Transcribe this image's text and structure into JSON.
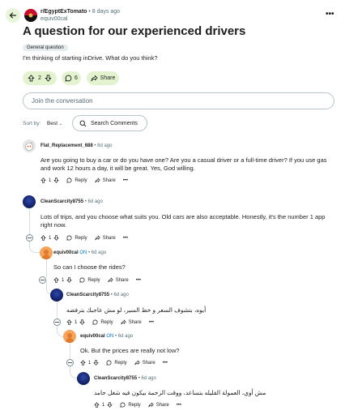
{
  "header": {
    "subreddit": "r/EgyptExTomato",
    "time": "• 8 days ago",
    "author": "equiv00cal",
    "more": "•••"
  },
  "post": {
    "title": "A question for our experienced drivers",
    "flair": "General question",
    "body": "I'm thinking of starting inDrive. What do you think?",
    "votes": "2",
    "comments": "6",
    "share": "Share"
  },
  "join_placeholder": "Join the conversation",
  "sort": {
    "label": "Sort by:",
    "value": "Best",
    "search": "Search Comments"
  },
  "labels": {
    "reply": "Reply",
    "share": "Share",
    "more": "•••",
    "on": "OP"
  },
  "comments": [
    {
      "author": "Flat_Replacement_688",
      "time": "• 8d ago",
      "text": "Are you going to buy a car or do you have one? Are you a casual driver or a full-time driver? If you use gas and work 12 hours a day, it will be great. Yes, God willing.",
      "votes": "1"
    },
    {
      "author": "CleanScarcity8755",
      "time": "• 6d ago",
      "text": "Lots of trips, and you choose what suits you. Old cars are also acceptable. Honestly, it's the number 1 app right now.",
      "votes": "1"
    },
    {
      "author": "equiv00cal",
      "op": "ON",
      "time": "• 6d ago",
      "text": "So can I choose the rides?",
      "votes": "1"
    },
    {
      "author": "CleanScarcity8755",
      "time": "• 6d ago",
      "text": "أيوه، بتشوف السعر و خط السير، لو مش عاجبك بترفضه",
      "votes": "1"
    },
    {
      "author": "equiv00cal",
      "op": "ON",
      "time": "• 6d ago",
      "text": "Ok. But the prices are really not low?",
      "votes": "1"
    },
    {
      "author": "CleanScarcity8755",
      "time": "• 6d ago",
      "text": "مش أوي، العمولة القليله بتساعد، ووقت الزحمة بيكون فيه شغل جامد",
      "votes": "1"
    }
  ]
}
